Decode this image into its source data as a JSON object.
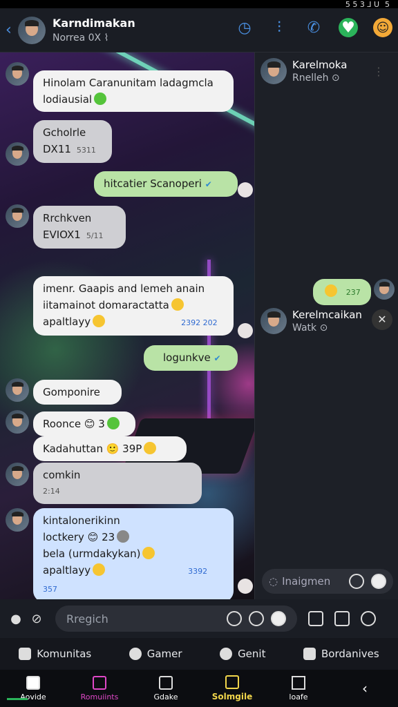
{
  "status": {
    "left": "",
    "right": "5 5 3 ⅃ U",
    "far_right": "5"
  },
  "header": {
    "name": "Karndimakan",
    "subtitle": "Norrea 0X ⌇"
  },
  "messages": [
    {
      "id": "m1",
      "text": "Hinolam Caranunitam ladagmcla lodiausial"
    },
    {
      "id": "m2",
      "text1": "Gcholrle",
      "text2": "DX11",
      "meta": "5311"
    },
    {
      "id": "m3",
      "text": "hitcatier Scanoperi"
    },
    {
      "id": "m4",
      "text1": "Rrchkven",
      "text2": "EVIOX1",
      "meta": "5/11"
    },
    {
      "id": "m5",
      "text1": "imenr. Gaapis and lemeh anain",
      "text2": "iitamainot domaractatta",
      "text3": "apaltlayy",
      "meta": "2392 202"
    },
    {
      "id": "m6",
      "text": "logunkve"
    },
    {
      "id": "m7",
      "text": "Gomponire"
    },
    {
      "id": "m8",
      "text": "Roonce 😊 3"
    },
    {
      "id": "m9",
      "text": "Kadahuttan 🙂 39P"
    },
    {
      "id": "m10",
      "text1": "comkin",
      "text2": "2:14"
    },
    {
      "id": "m11",
      "text1": "kintalonerikinn",
      "text2": "loctkery 😊 23",
      "text3": "bela (urmdakykan)",
      "text4": "apaltlayy",
      "meta": "3392 357"
    }
  ],
  "right_panel": {
    "contact1": {
      "name": "Karelmoka",
      "status": "Rnelleh ⊙"
    },
    "bubble": {
      "text": "237"
    },
    "contact2": {
      "name": "Kerelmcaikan",
      "status": "Watk ⊙"
    },
    "input_placeholder": "Inaigmen"
  },
  "input": {
    "placeholder": "Rregich"
  },
  "tabs": [
    "Komunitas",
    "Gamer",
    "Genit",
    "Bordanives"
  ],
  "nav": [
    "Aovide",
    "Romuiints",
    "Gdake",
    "Solmgile",
    "loafe"
  ]
}
